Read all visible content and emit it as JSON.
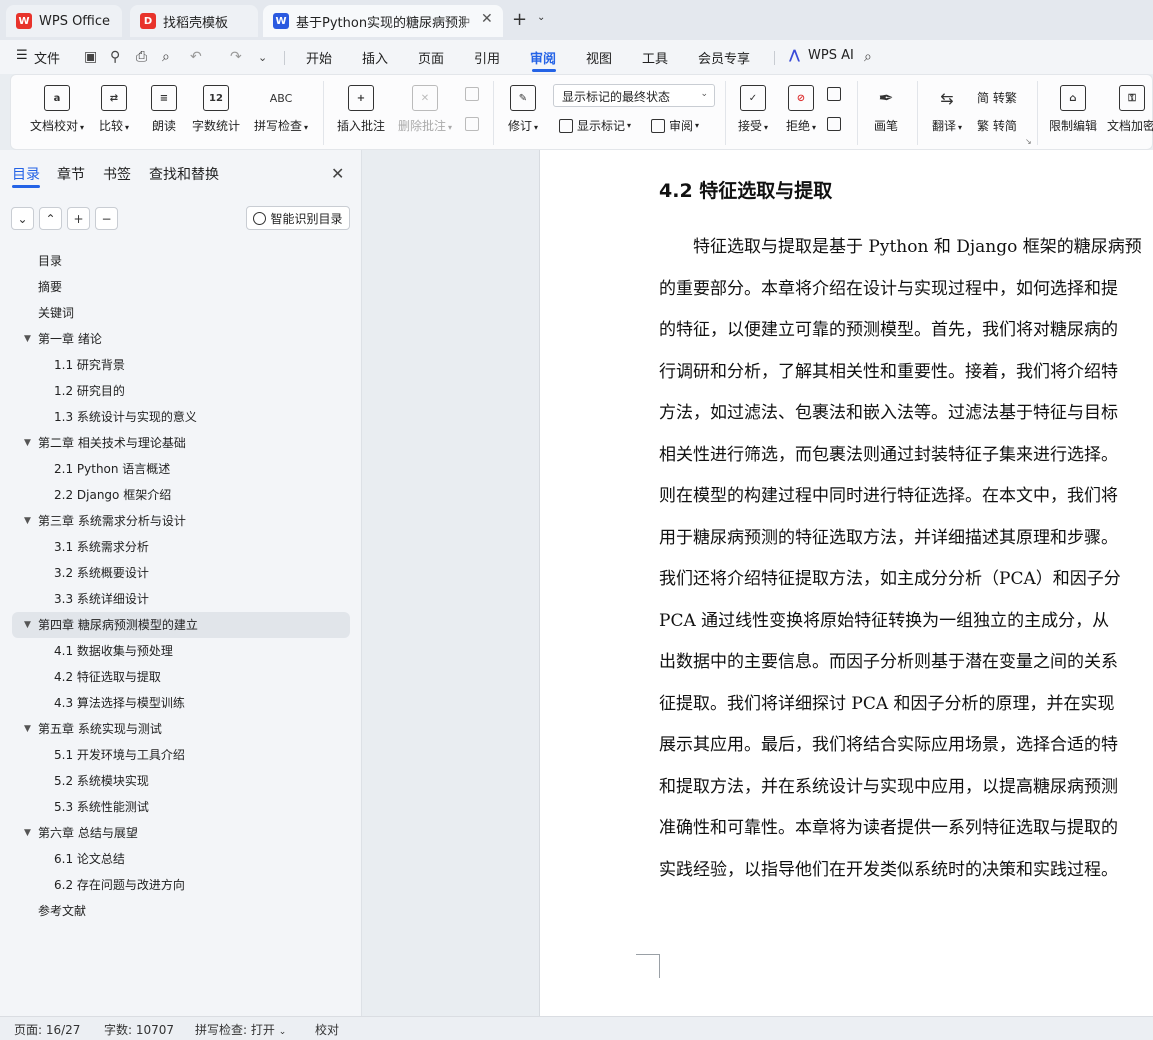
{
  "tabs": [
    {
      "label": "WPS Office",
      "logo": "W",
      "color": "#e8332b"
    },
    {
      "label": "找稻壳模板",
      "logo": "D",
      "color": "#e8332b"
    },
    {
      "label": "基于Python实现的糖尿病预测",
      "logo": "W",
      "color": "#2b5ae0"
    }
  ],
  "menu": {
    "file": "文件",
    "items": [
      "开始",
      "插入",
      "页面",
      "引用",
      "审阅",
      "视图",
      "工具",
      "会员专享"
    ],
    "active": "审阅",
    "ai": "WPS AI"
  },
  "ribbon": {
    "doc_proof": "文档校对",
    "compare": "比较",
    "read_aloud": "朗读",
    "word_count": "字数统计",
    "spell_check": "拼写检查",
    "insert_comment": "插入批注",
    "delete_comment": "删除批注",
    "track_changes": "修订",
    "markup_dropdown": "显示标记的最终状态",
    "show_markup": "显示标记",
    "review": "审阅",
    "accept": "接受",
    "reject": "拒绝",
    "pen": "画笔",
    "translate": "翻译",
    "to_traditional": "简 转繁",
    "to_simplified": "繁 转简",
    "restrict_edit": "限制编辑",
    "doc_encrypt": "文档加密"
  },
  "nav": {
    "tabs": [
      "目录",
      "章节",
      "书签",
      "查找和替换"
    ],
    "smart_toc": "智能识别目录",
    "toc": [
      {
        "text": "目录",
        "level": 1,
        "arrow": false
      },
      {
        "text": "摘要",
        "level": 1,
        "arrow": false
      },
      {
        "text": "关键词",
        "level": 1,
        "arrow": false
      },
      {
        "text": "第一章  绪论",
        "level": 1,
        "arrow": true
      },
      {
        "text": "1.1  研究背景",
        "level": 2,
        "arrow": false
      },
      {
        "text": "1.2  研究目的",
        "level": 2,
        "arrow": false
      },
      {
        "text": "1.3  系统设计与实现的意义",
        "level": 2,
        "arrow": false
      },
      {
        "text": "第二章  相关技术与理论基础",
        "level": 1,
        "arrow": true
      },
      {
        "text": "2.1 Python 语言概述",
        "level": 2,
        "arrow": false
      },
      {
        "text": "2.2 Django 框架介绍",
        "level": 2,
        "arrow": false
      },
      {
        "text": "第三章  系统需求分析与设计",
        "level": 1,
        "arrow": true
      },
      {
        "text": "3.1  系统需求分析",
        "level": 2,
        "arrow": false
      },
      {
        "text": "3.2  系统概要设计",
        "level": 2,
        "arrow": false
      },
      {
        "text": "3.3  系统详细设计",
        "level": 2,
        "arrow": false
      },
      {
        "text": "第四章  糖尿病预测模型的建立",
        "level": 1,
        "arrow": true,
        "active": true
      },
      {
        "text": "4.1  数据收集与预处理",
        "level": 2,
        "arrow": false
      },
      {
        "text": "4.2  特征选取与提取",
        "level": 2,
        "arrow": false
      },
      {
        "text": "4.3  算法选择与模型训练",
        "level": 2,
        "arrow": false
      },
      {
        "text": "第五章  系统实现与测试",
        "level": 1,
        "arrow": true
      },
      {
        "text": "5.1  开发环境与工具介绍",
        "level": 2,
        "arrow": false
      },
      {
        "text": "5.2  系统模块实现",
        "level": 2,
        "arrow": false
      },
      {
        "text": "5.3  系统性能测试",
        "level": 2,
        "arrow": false
      },
      {
        "text": "第六章  总结与展望",
        "level": 1,
        "arrow": true
      },
      {
        "text": "6.1  论文总结",
        "level": 2,
        "arrow": false
      },
      {
        "text": "6.2  存在问题与改进方向",
        "level": 2,
        "arrow": false
      },
      {
        "text": "参考文献",
        "level": 1,
        "arrow": false
      }
    ]
  },
  "document": {
    "heading": "4.2  特征选取与提取",
    "lines": [
      "　　特征选取与提取是基于 Python 和 Django 框架的糖尿病预",
      "的重要部分。本章将介绍在设计与实现过程中，如何选择和提",
      "的特征，以便建立可靠的预测模型。首先，我们将对糖尿病的",
      "行调研和分析，了解其相关性和重要性。接着，我们将介绍特",
      "方法，如过滤法、包裹法和嵌入法等。过滤法基于特征与目标",
      "相关性进行筛选，而包裹法则通过封装特征子集来进行选择。",
      "则在模型的构建过程中同时进行特征选择。在本文中，我们将",
      "用于糖尿病预测的特征选取方法，并详细描述其原理和步骤。",
      "我们还将介绍特征提取方法，如主成分分析（PCA）和因子分",
      "PCA 通过线性变换将原始特征转换为一组独立的主成分，从",
      "出数据中的主要信息。而因子分析则基于潜在变量之间的关系",
      "征提取。我们将详细探讨 PCA 和因子分析的原理，并在实现",
      "展示其应用。最后，我们将结合实际应用场景，选择合适的特",
      "和提取方法，并在系统设计与实现中应用，以提高糖尿病预测",
      "准确性和可靠性。本章将为读者提供一系列特征选取与提取的",
      "实践经验，以指导他们在开发类似系统时的决策和实践过程。"
    ]
  },
  "status": {
    "page": "页面: 16/27",
    "words": "字数: 10707",
    "spell": "拼写检查: 打开",
    "proof": "校对"
  }
}
